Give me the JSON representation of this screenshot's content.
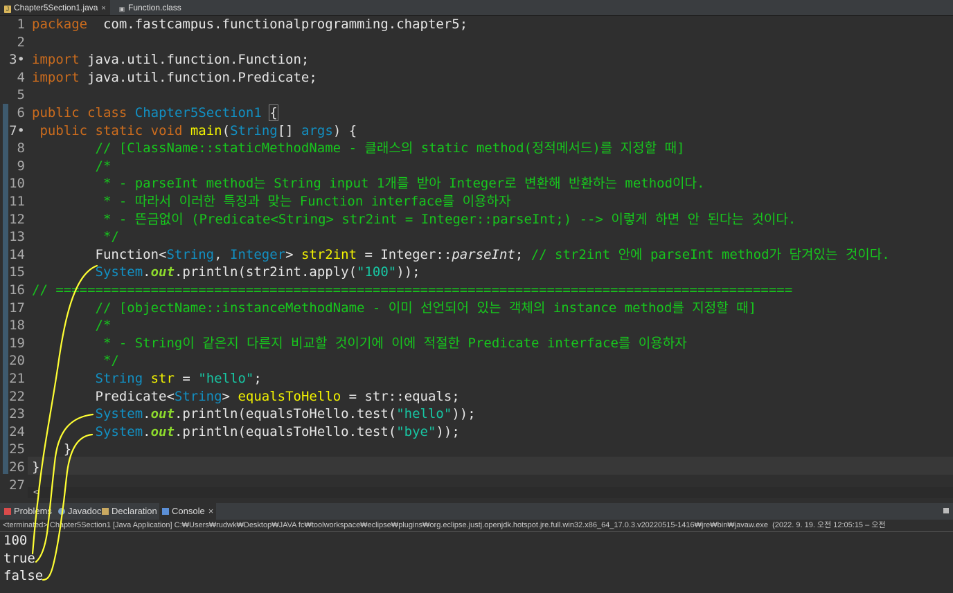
{
  "tabs": [
    {
      "label": "Chapter5Section1.java",
      "icon": "java-file-icon",
      "active": true
    },
    {
      "label": "Function.class",
      "icon": "class-file-icon",
      "active": false
    }
  ],
  "close_glyph": "×",
  "lines": [
    {
      "n": "1",
      "tokens": [
        [
          "kw",
          "package"
        ],
        [
          "",
          "  com.fastcampus.functionalprogramming.chapter5;"
        ]
      ]
    },
    {
      "n": "2",
      "tokens": []
    },
    {
      "n": "3",
      "fold": true,
      "tokens": [
        [
          "kw",
          "import"
        ],
        [
          "",
          " java.util.function.Function;"
        ]
      ]
    },
    {
      "n": "4",
      "tokens": [
        [
          "kw",
          "import"
        ],
        [
          "",
          " java.util.function.Predicate;"
        ]
      ]
    },
    {
      "n": "5",
      "tokens": []
    },
    {
      "n": "6",
      "tokens": [
        [
          "kw",
          "public"
        ],
        [
          "",
          " "
        ],
        [
          "kw",
          "class"
        ],
        [
          "",
          " "
        ],
        [
          "ty",
          "Chapter5Section1"
        ],
        [
          "",
          " "
        ],
        [
          "br",
          "{"
        ]
      ]
    },
    {
      "n": "7",
      "fold": true,
      "tokens": [
        [
          "",
          " "
        ],
        [
          "kw",
          "public"
        ],
        [
          "",
          " "
        ],
        [
          "kw",
          "static"
        ],
        [
          "",
          " "
        ],
        [
          "kw",
          "void"
        ],
        [
          "",
          " "
        ],
        [
          "vr",
          "main"
        ],
        [
          "",
          "("
        ],
        [
          "ty",
          "String"
        ],
        [
          "",
          "[] "
        ],
        [
          "ty",
          "args"
        ],
        [
          "",
          ") {"
        ]
      ]
    },
    {
      "n": "8",
      "tokens": [
        [
          "",
          "        "
        ],
        [
          "cm",
          "// [ClassName::staticMethodName - 클래스의 static method(정적메서드)를 지정할 때]"
        ]
      ]
    },
    {
      "n": "9",
      "tokens": [
        [
          "",
          "        "
        ],
        [
          "cm",
          "/*"
        ]
      ]
    },
    {
      "n": "10",
      "tokens": [
        [
          "",
          "         "
        ],
        [
          "cm",
          "* - parseInt method는 String input 1개를 받아 Integer로 변환해 반환하는 method이다."
        ]
      ]
    },
    {
      "n": "11",
      "tokens": [
        [
          "",
          "         "
        ],
        [
          "cm",
          "* - 따라서 이러한 특징과 맞는 Function interface를 이용하자"
        ]
      ]
    },
    {
      "n": "12",
      "tokens": [
        [
          "",
          "         "
        ],
        [
          "cm",
          "* - 뜬금없이 (Predicate<String> str2int = Integer::parseInt;) --> 이렇게 하면 안 된다는 것이다."
        ]
      ]
    },
    {
      "n": "13",
      "tokens": [
        [
          "",
          "         "
        ],
        [
          "cm",
          "*/"
        ]
      ]
    },
    {
      "n": "14",
      "tokens": [
        [
          "",
          "        Function<"
        ],
        [
          "ty",
          "String"
        ],
        [
          "",
          ", "
        ],
        [
          "ty",
          "Integer"
        ],
        [
          "",
          "> "
        ],
        [
          "vr",
          "str2int"
        ],
        [
          "",
          " = Integer::"
        ],
        [
          "it",
          "parseInt"
        ],
        [
          "",
          "; "
        ],
        [
          "cm",
          "// str2int 안에 parseInt method가 담겨있는 것이다."
        ]
      ]
    },
    {
      "n": "15",
      "tokens": [
        [
          "",
          "        "
        ],
        [
          "ty",
          "System"
        ],
        [
          "",
          "."
        ],
        [
          "fl",
          "out"
        ],
        [
          "",
          ".println(str2int.apply("
        ],
        [
          "st",
          "\"100\""
        ],
        [
          "",
          "));"
        ]
      ]
    },
    {
      "n": "16",
      "tokens": [
        [
          "cm",
          "// ============================================================================================="
        ]
      ]
    },
    {
      "n": "17",
      "tokens": [
        [
          "",
          "        "
        ],
        [
          "cm",
          "// [objectName::instanceMethodName - 이미 선언되어 있는 객체의 instance method를 지정할 때]"
        ]
      ]
    },
    {
      "n": "18",
      "tokens": [
        [
          "",
          "        "
        ],
        [
          "cm",
          "/*"
        ]
      ]
    },
    {
      "n": "19",
      "tokens": [
        [
          "",
          "         "
        ],
        [
          "cm",
          "* - String이 같은지 다른지 비교할 것이기에 이에 적절한 Predicate interface를 이용하자"
        ]
      ]
    },
    {
      "n": "20",
      "tokens": [
        [
          "",
          "         "
        ],
        [
          "cm",
          "*/"
        ]
      ]
    },
    {
      "n": "21",
      "tokens": [
        [
          "",
          "        "
        ],
        [
          "ty",
          "String"
        ],
        [
          "",
          " "
        ],
        [
          "vr",
          "str"
        ],
        [
          "",
          " = "
        ],
        [
          "st",
          "\"hello\""
        ],
        [
          "",
          ";"
        ]
      ]
    },
    {
      "n": "22",
      "tokens": [
        [
          "",
          "        Predicate<"
        ],
        [
          "ty",
          "String"
        ],
        [
          "",
          "> "
        ],
        [
          "vr",
          "equalsToHello"
        ],
        [
          "",
          " = str::equals;"
        ]
      ]
    },
    {
      "n": "23",
      "tokens": [
        [
          "",
          "        "
        ],
        [
          "ty",
          "System"
        ],
        [
          "",
          "."
        ],
        [
          "fl",
          "out"
        ],
        [
          "",
          ".println(equalsToHello.test("
        ],
        [
          "st",
          "\"hello\""
        ],
        [
          "",
          "));"
        ]
      ]
    },
    {
      "n": "24",
      "tokens": [
        [
          "",
          "        "
        ],
        [
          "ty",
          "System"
        ],
        [
          "",
          "."
        ],
        [
          "fl",
          "out"
        ],
        [
          "",
          ".println(equalsToHello.test("
        ],
        [
          "st",
          "\"bye\""
        ],
        [
          "",
          "));"
        ]
      ]
    },
    {
      "n": "25",
      "tokens": [
        [
          "",
          "    }"
        ]
      ]
    },
    {
      "n": "26",
      "tokens": [
        [
          "",
          "}"
        ]
      ]
    },
    {
      "n": "27",
      "tokens": []
    }
  ],
  "panel_tabs": [
    {
      "label": "Problems",
      "icon": "problems-icon",
      "active": false
    },
    {
      "label": "Javadoc",
      "icon": "javadoc-icon",
      "active": false
    },
    {
      "label": "Declaration",
      "icon": "declaration-icon",
      "active": false
    },
    {
      "label": "Console",
      "icon": "console-icon",
      "active": true
    }
  ],
  "console": {
    "status": "<terminated> Chapter5Section1 [Java Application] C:₩Users₩rudwk₩Desktop₩JAVA fc₩toolworkspace₩eclipse₩plugins₩org.eclipse.justj.openjdk.hotspot.jre.full.win32.x86_64_17.0.3.v20220515-1416₩jre₩bin₩javaw.exe  (2022. 9. 19. 오전 12:05:15 – 오전",
    "output": [
      "100",
      "true",
      "false"
    ]
  },
  "colors": {
    "keyword": "#cc6c1d",
    "type": "#1290c3",
    "comment": "#17c61d",
    "string": "#17c6a3",
    "variable": "#f2f200",
    "annotation": "#ffff33"
  }
}
